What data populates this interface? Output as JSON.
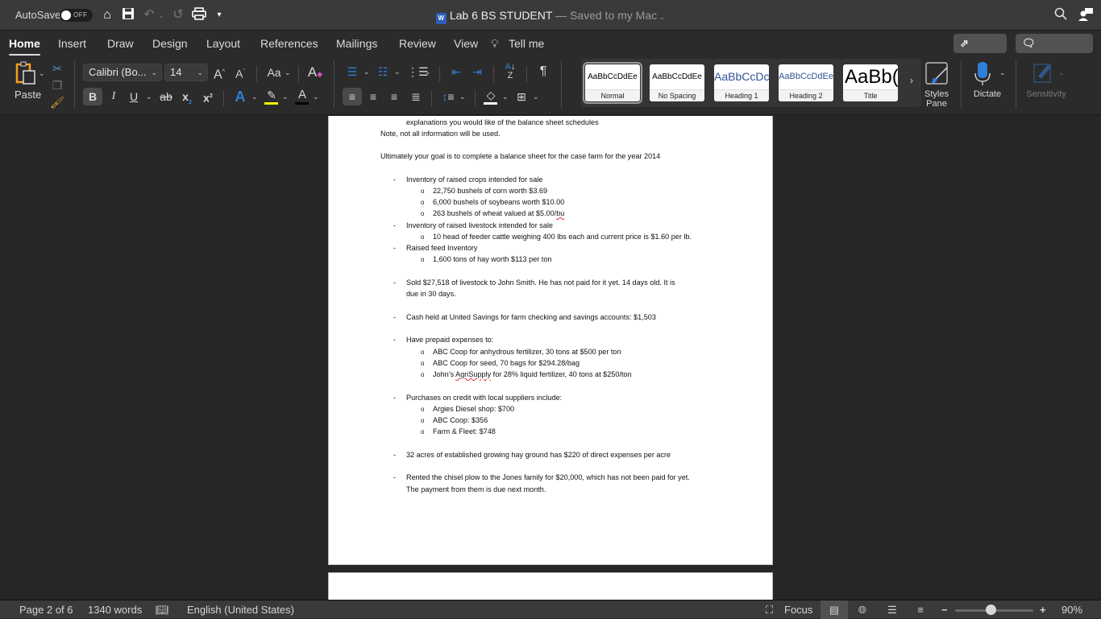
{
  "titlebar": {
    "autosave_label": "AutoSave",
    "autosave_state": "OFF",
    "doc_name": "Lab 6 BS STUDENT",
    "save_status": "— Saved to my Mac",
    "icons": [
      "home-icon",
      "save-icon",
      "undo-icon",
      "redo-icon",
      "print-icon",
      "customize-toolbar-icon",
      "search-icon",
      "account-icon"
    ]
  },
  "tabs": [
    {
      "label": "Home",
      "active": true
    },
    {
      "label": "Insert"
    },
    {
      "label": "Draw"
    },
    {
      "label": "Design"
    },
    {
      "label": "Layout"
    },
    {
      "label": "References"
    },
    {
      "label": "Mailings"
    },
    {
      "label": "Review"
    },
    {
      "label": "View"
    },
    {
      "label": "Tell me"
    }
  ],
  "header_buttons": {
    "share": "Share",
    "comments": "Comments"
  },
  "ribbon": {
    "paste_label": "Paste",
    "font_name": "Calibri (Bo...",
    "font_size": "14",
    "change_case": "Aa",
    "styles": [
      {
        "preview": "AaBbCcDdEe",
        "name": "Normal",
        "selected": true
      },
      {
        "preview": "AaBbCcDdEe",
        "name": "No Spacing"
      },
      {
        "preview": "AaBbCcDc",
        "name": "Heading 1"
      },
      {
        "preview": "AaBbCcDdEe",
        "name": "Heading 2"
      },
      {
        "preview": "AaBb(",
        "name": "Title"
      }
    ],
    "styles_pane_label": "Styles Pane",
    "dictate_label": "Dictate",
    "sensitivity_label": "Sensitivity",
    "highlight_color": "#f5f000",
    "font_color": "#000000",
    "accent_color": "#2f7fd6"
  },
  "document": {
    "lines": [
      {
        "kind": "cont",
        "text": "explanations you would like of the balance sheet schedules"
      },
      {
        "kind": "plain",
        "text": "Note, not all information will be used."
      },
      {
        "kind": "plain",
        "text": "Ultimately your goal is to complete a balance sheet for the case farm for the year 2014"
      },
      {
        "kind": "bullet",
        "text": "Inventory of raised crops intended for sale"
      },
      {
        "kind": "sub",
        "text": "22,750 bushels of corn worth $3.69"
      },
      {
        "kind": "sub",
        "text": "6,000 bushels of soybeans worth $10.00"
      },
      {
        "kind": "sub",
        "text": "263 bushels of wheat valued at $5.00/",
        "flag": "bu"
      },
      {
        "kind": "bullet",
        "text": "Inventory of raised livestock intended for sale"
      },
      {
        "kind": "sub",
        "text": "10 head of feeder cattle weighing 400 lbs each and current price is $1.60 per lb."
      },
      {
        "kind": "bullet",
        "text": "Raised feed Inventory"
      },
      {
        "kind": "sub",
        "text": "1,600 tons of hay worth $113 per ton"
      },
      {
        "kind": "bullet",
        "text": "Sold $27,518 of livestock to John Smith.  He has not paid for it yet.  14 days old.   It is"
      },
      {
        "kind": "cont",
        "text": "due in 30 days."
      },
      {
        "kind": "bullet",
        "text": "Cash held at United Savings for farm checking and savings accounts:  $1,503"
      },
      {
        "kind": "bullet",
        "text": "Have prepaid expenses to:"
      },
      {
        "kind": "sub",
        "text": "ABC Coop for anhydrous fertilizer, 30 tons at $500 per ton"
      },
      {
        "kind": "sub",
        "text": "ABC Coop for seed, 70 bags for $294.28/bag"
      },
      {
        "kind": "sub",
        "pre": "John’s ",
        "flag": "AgriSupply",
        "text": " for 28% liquid fertilizer, 40 tons at $250/ton"
      },
      {
        "kind": "bullet",
        "text": "Purchases on credit with local suppliers include:"
      },
      {
        "kind": "sub",
        "text": "Argies Diesel shop: $700"
      },
      {
        "kind": "sub",
        "text": "ABC Coop: $356"
      },
      {
        "kind": "sub",
        "text": "Farm & Fleet: $748"
      },
      {
        "kind": "bullet",
        "text": "32 acres of established growing hay ground has $220 of direct expenses per acre"
      },
      {
        "kind": "bullet",
        "text": "Rented the chisel plow to the Jones family for $20,000, which has not been paid for yet."
      },
      {
        "kind": "cont",
        "text": "The payment from them is due next month."
      }
    ]
  },
  "status": {
    "page": "Page 2 of 6",
    "words": "1340 words",
    "language": "English (United States)",
    "focus": "Focus",
    "zoom": "90%",
    "zoom_fraction": 0.45
  }
}
